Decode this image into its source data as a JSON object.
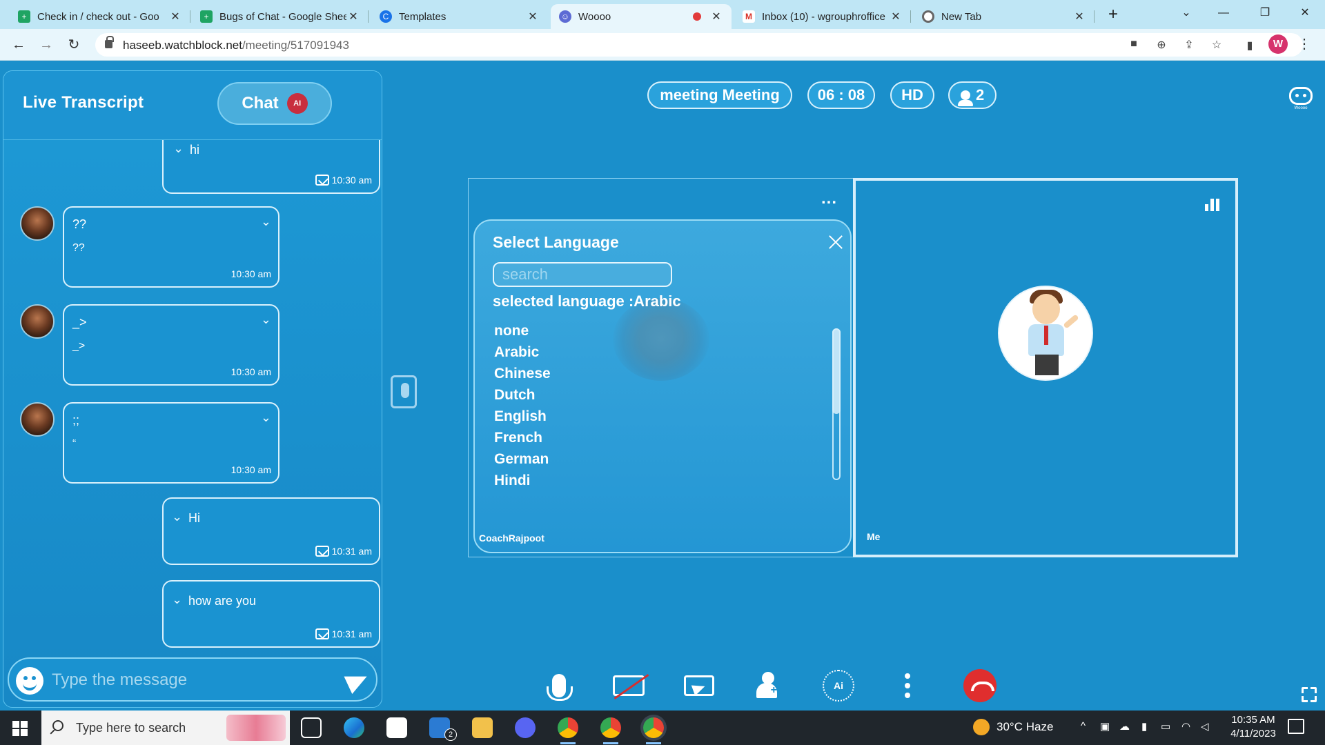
{
  "browser": {
    "tabs": [
      {
        "title": "Check in / check out - Goo",
        "icon": "google-sheets-icon"
      },
      {
        "title": "Bugs of Chat - Google Shee",
        "icon": "google-sheets-icon"
      },
      {
        "title": "Templates",
        "icon": "canva-icon"
      },
      {
        "title": "Woooo",
        "icon": "woooo-robot-icon",
        "active": true,
        "recording": true
      },
      {
        "title": "Inbox (10) - wgrouphroffice",
        "icon": "gmail-icon"
      },
      {
        "title": "New Tab",
        "icon": "chrome-icon"
      }
    ],
    "url_host": "haseeb.watchblock.net",
    "url_path": "/meeting/517091943",
    "profile_initial": "W"
  },
  "left_panel": {
    "title": "Live Transcript",
    "chat_button": "Chat",
    "chat_badge": "AI",
    "messages": [
      {
        "side": "mine",
        "text": "hi",
        "time": "10:30 am"
      },
      {
        "side": "theirs",
        "text": "??",
        "sub": "??",
        "time": "10:30 am"
      },
      {
        "side": "theirs",
        "text": "_>",
        "sub": "_>",
        "time": "10:30 am"
      },
      {
        "side": "theirs",
        "text": ";;",
        "sub": "“",
        "time": "10:30 am"
      },
      {
        "side": "mine",
        "text": "Hi",
        "time": "10:31 am"
      },
      {
        "side": "mine",
        "text": "how are you",
        "time": "10:31 am"
      }
    ],
    "composer_placeholder": "Type the message"
  },
  "meeting": {
    "name": "meeting Meeting",
    "timer": "06 : 08",
    "quality": "HD",
    "participants": "2",
    "brand_label": "Woooo"
  },
  "language_modal": {
    "title": "Select Language",
    "search_placeholder": "search",
    "selected_label": "selected language :Arabic",
    "languages": [
      "none",
      "Arabic",
      "Chinese",
      "Dutch",
      "English",
      "French",
      "German",
      "Hindi"
    ]
  },
  "tiles": {
    "left_name": "CoachRajpoot",
    "left_menu": "...",
    "right_name": "Me"
  },
  "taskbar": {
    "search_placeholder": "Type here to search",
    "weather": "30°C  Haze",
    "time": "10:35 AM",
    "date": "4/11/2023",
    "mail_badge": "2"
  },
  "colors": {
    "background": "#1a8fcb",
    "end_call": "#e02e2e",
    "recording": "#e23b3b"
  }
}
